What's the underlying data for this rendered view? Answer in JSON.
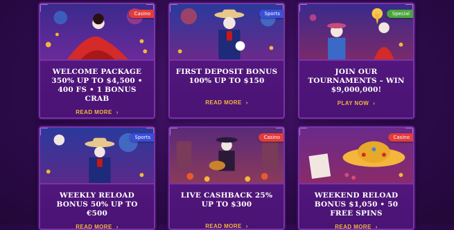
{
  "cards": [
    {
      "tag": "Casino",
      "tag_color": "#e23c3c",
      "title": "WELCOME PACKAGE 350% UP TO $4,500 • 400 FS • 1 BONUS CRAB",
      "cta": "READ MORE"
    },
    {
      "tag": "Sports",
      "tag_color": "#3a4fd6",
      "title": "FIRST DEPOSIT BONUS 100% UP TO $150",
      "cta": "READ MORE"
    },
    {
      "tag": "Special",
      "tag_color": "#4aa63c",
      "title": "JOIN OUR TOURNAMENTS – WIN $9,000,000!",
      "cta": "PLAY NOW"
    },
    {
      "tag": "Sports",
      "tag_color": "#3a4fd6",
      "title": "WEEKLY RELOAD BONUS 50% UP TO €500",
      "cta": "READ MORE"
    },
    {
      "tag": "Casino",
      "tag_color": "#e23c3c",
      "title": "LIVE CASHBACK 25% UP TO $300",
      "cta": "READ MORE"
    },
    {
      "tag": "Casino",
      "tag_color": "#e23c3c",
      "title": "WEEKEND RELOAD BONUS $1,050 • 50 FREE SPINS",
      "cta": "READ MORE"
    }
  ],
  "icons": {
    "chevron": "chevron-right-icon"
  }
}
